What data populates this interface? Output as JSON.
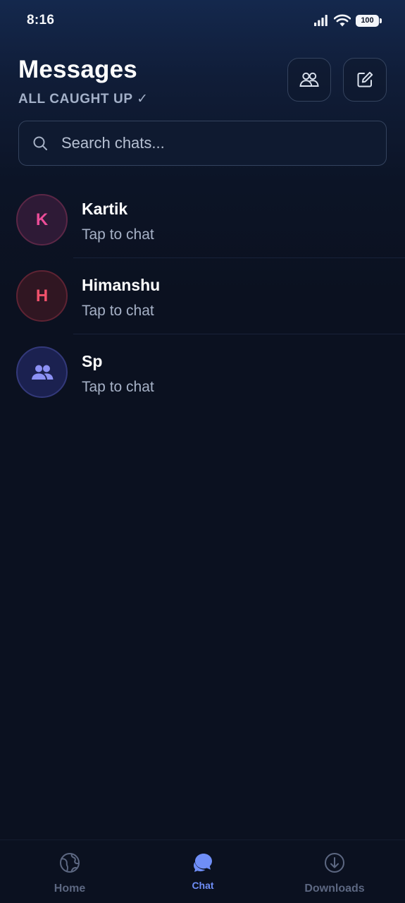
{
  "status_bar": {
    "time": "8:16",
    "battery": "100",
    "icons": [
      "signal-icon",
      "wifi-icon",
      "battery-icon"
    ]
  },
  "header": {
    "title": "Messages",
    "subtitle": "ALL CAUGHT UP ✓",
    "buttons": [
      {
        "icon": "group-icon"
      },
      {
        "icon": "compose-icon"
      }
    ]
  },
  "search": {
    "placeholder": "Search chats...",
    "value": ""
  },
  "chats": [
    {
      "name": "Kartik",
      "preview": "Tap to chat",
      "avatar_letter": "K",
      "avatar_color": "#ec4d99"
    },
    {
      "name": "Himanshu",
      "preview": "Tap to chat",
      "avatar_letter": "H",
      "avatar_color": "#f0516b"
    },
    {
      "name": "Sp",
      "preview": "Tap to chat",
      "avatar_icon": "group-icon",
      "avatar_color": "#8c91f5"
    }
  ],
  "bottom_nav": {
    "items": [
      {
        "label": "Home",
        "icon": "globe-icon",
        "active": false
      },
      {
        "label": "Chat",
        "icon": "chat-bubbles-icon",
        "active": true
      },
      {
        "label": "Downloads",
        "icon": "download-icon",
        "active": false
      }
    ]
  },
  "colors": {
    "background": "#0b1120",
    "accent": "#6f8ef7",
    "text_primary": "#ffffff",
    "text_secondary": "#a6b1c6"
  }
}
